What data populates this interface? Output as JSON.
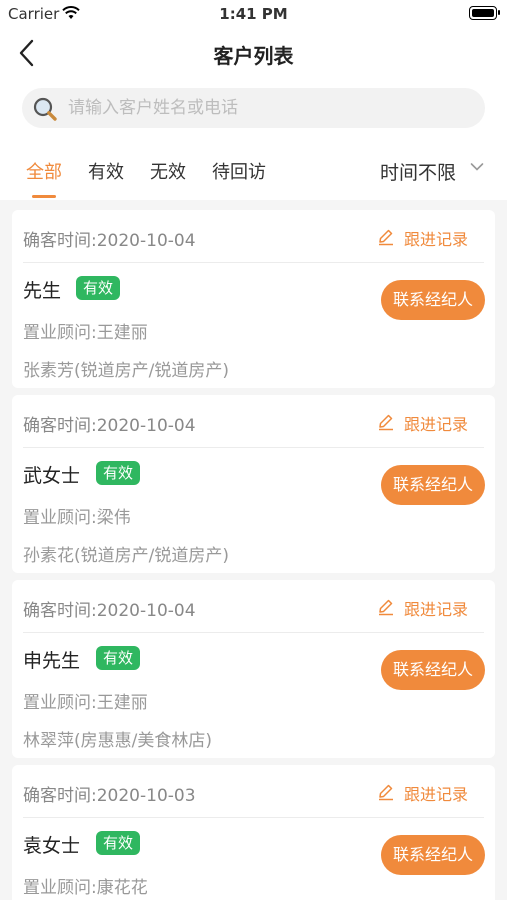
{
  "status_bar": {
    "carrier": "Carrier",
    "time": "1:41 PM"
  },
  "nav": {
    "title": "客户列表",
    "back_icon": "chevron-left-icon"
  },
  "search": {
    "placeholder": "请输入客户姓名或电话",
    "value": "",
    "icon": "search-icon"
  },
  "tabs": [
    {
      "label": "全部",
      "active": true
    },
    {
      "label": "有效",
      "active": false
    },
    {
      "label": "无效",
      "active": false
    },
    {
      "label": "待回访",
      "active": false
    }
  ],
  "time_filter": {
    "label": "时间不限",
    "icon": "chevron-down-icon"
  },
  "follow_label": "跟进记录",
  "contact_label": "联系经纪人",
  "colors": {
    "accent": "#f08a3c",
    "valid_badge": "#2fb760"
  },
  "customers": [
    {
      "confirm_time": "确客时间:2020-10-04",
      "name": "先生",
      "status": "有效",
      "adviser": "置业顾问:王建丽",
      "agent": "张素芳(锐道房产/锐道房产)"
    },
    {
      "confirm_time": "确客时间:2020-10-04",
      "name": "武女士",
      "status": "有效",
      "adviser": "置业顾问:梁伟",
      "agent": "孙素花(锐道房产/锐道房产)"
    },
    {
      "confirm_time": "确客时间:2020-10-04",
      "name": "申先生",
      "status": "有效",
      "adviser": "置业顾问:王建丽",
      "agent": "林翠萍(房惠惠/美食林店)"
    },
    {
      "confirm_time": "确客时间:2020-10-03",
      "name": "袁女士",
      "status": "有效",
      "adviser": "置业顾问:康花花",
      "agent": ""
    }
  ]
}
